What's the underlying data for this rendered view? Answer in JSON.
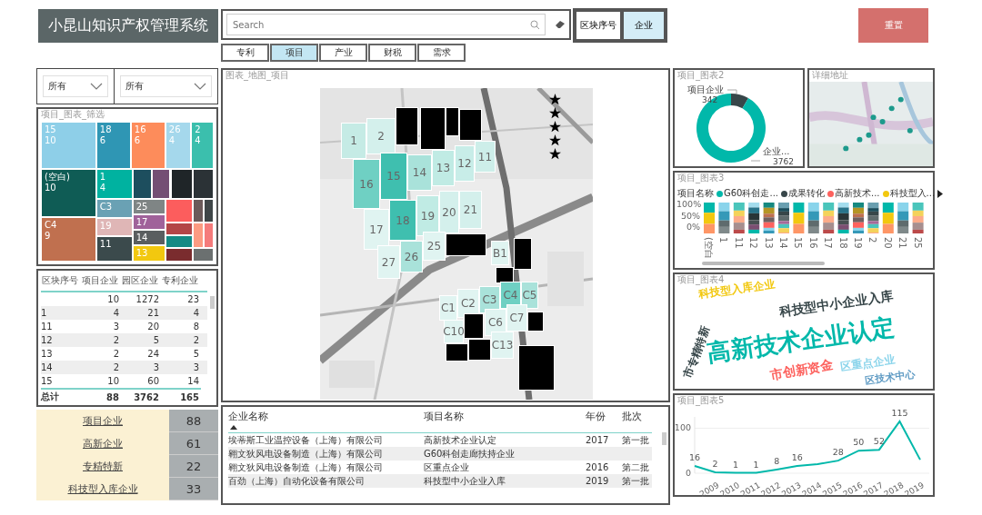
{
  "header": {
    "title": "小昆山知识产权管理系统",
    "search": {
      "placeholder": "Search"
    },
    "view_buttons": [
      {
        "label": "区块序号",
        "selected": false
      },
      {
        "label": "企业",
        "selected": true
      }
    ],
    "reset_button": "重置"
  },
  "tabs": [
    {
      "label": "专利",
      "selected": false
    },
    {
      "label": "项目",
      "selected": true
    },
    {
      "label": "产业",
      "selected": false
    },
    {
      "label": "财税",
      "selected": false
    },
    {
      "label": "需求",
      "selected": false
    }
  ],
  "filters": [
    {
      "value": "所有"
    },
    {
      "value": "所有"
    }
  ],
  "treemap": {
    "title": "项目_图表_筛选",
    "tiles": [
      {
        "label": "15",
        "value": "10",
        "color": "#8ecfe8"
      },
      {
        "label": "18",
        "value": "6",
        "color": "#2f96b4"
      },
      {
        "label": "16",
        "value": "6",
        "color": "#fd8c5b"
      },
      {
        "label": "26",
        "value": "4",
        "color": "#a5d8ec"
      },
      {
        "label": "2",
        "value": "4",
        "color": "#3bbfad"
      },
      {
        "label": "(空白)",
        "value": "10",
        "color": "#0f5c55"
      },
      {
        "label": "1",
        "value": "4",
        "color": "#00b2a0"
      },
      {
        "color": "#1d4e5e"
      },
      {
        "color": "#744e74"
      },
      {
        "color": "#1f2528"
      },
      {
        "color": "#2b3236"
      },
      {
        "label": "C3",
        "color": "#6aa1b4"
      },
      {
        "label": "25",
        "color": "#7f8585"
      },
      {
        "label": "17",
        "color": "#a0629a"
      },
      {
        "label": "14",
        "color": "#5a5e60"
      },
      {
        "label": "13",
        "color": "#f2c80f"
      },
      {
        "color": "#fc5d5d"
      },
      {
        "color": "#6b5a5a"
      },
      {
        "color": "#3f4648"
      },
      {
        "color": "#b34547"
      },
      {
        "color": "#148a84"
      },
      {
        "color": "#7a2c2e"
      },
      {
        "color": "#fc9b82"
      },
      {
        "color": "#f57b7b"
      },
      {
        "color": "#6b7070"
      },
      {
        "label": "C4",
        "value": "9",
        "color": "#c0704f"
      },
      {
        "label": "19",
        "color": "#dfb6b6"
      },
      {
        "label": "11",
        "color": "#3b4a4c"
      }
    ]
  },
  "block_table": {
    "columns": [
      "区块序号",
      "项目企业",
      "园区企业",
      "专利企业"
    ],
    "rows": [
      [
        "",
        "10",
        "1272",
        "23"
      ],
      [
        "1",
        "4",
        "21",
        "4"
      ],
      [
        "11",
        "3",
        "20",
        "8"
      ],
      [
        "12",
        "2",
        "5",
        "2"
      ],
      [
        "13",
        "2",
        "24",
        "5"
      ],
      [
        "14",
        "2",
        "3",
        "3"
      ],
      [
        "15",
        "10",
        "60",
        "14"
      ]
    ],
    "total": [
      "总计",
      "88",
      "3762",
      "165"
    ]
  },
  "kpis": [
    {
      "label": "项目企业",
      "value": "88"
    },
    {
      "label": "高新企业",
      "value": "61"
    },
    {
      "label": "专精特新",
      "value": "22"
    },
    {
      "label": "科技型入库企业",
      "value": "33"
    }
  ],
  "map_panel": {
    "title": "图表_地图_项目",
    "blocks": [
      {
        "label": "1",
        "color": "#c5ebe5"
      },
      {
        "label": "2",
        "color": "#d4f0ec"
      },
      {
        "color": "#000000"
      },
      {
        "color": "#000000"
      },
      {
        "color": "#000000"
      },
      {
        "color": "#000000"
      },
      {
        "label": "16",
        "color": "#6fd0c3"
      },
      {
        "label": "15",
        "color": "#3fbfaf"
      },
      {
        "label": "14",
        "color": "#a9e2da"
      },
      {
        "label": "13",
        "color": "#c0ebe4"
      },
      {
        "label": "12",
        "color": "#c8ede8"
      },
      {
        "label": "11",
        "color": "#cdeee9"
      },
      {
        "label": "17",
        "color": "#e0f4f1"
      },
      {
        "label": "18",
        "color": "#3fbfaf"
      },
      {
        "label": "19",
        "color": "#c0ebe4"
      },
      {
        "label": "20",
        "color": "#d4f0ec"
      },
      {
        "label": "21",
        "color": "#d4f0ec"
      },
      {
        "label": "27",
        "color": "#e0f4f1"
      },
      {
        "label": "26",
        "color": "#a9e2da"
      },
      {
        "label": "25",
        "color": "#e0f4f1"
      },
      {
        "color": "#000000"
      },
      {
        "label": "B1",
        "color": "#e0f4f1"
      },
      {
        "color": "#000000"
      },
      {
        "color": "#000000"
      },
      {
        "label": "C1",
        "color": "#e0f4f1"
      },
      {
        "label": "C2",
        "color": "#e0f4f1"
      },
      {
        "label": "C3",
        "color": "#a9e2da"
      },
      {
        "label": "C4",
        "color": "#6fd0c3"
      },
      {
        "label": "C5",
        "color": "#a9e2da"
      },
      {
        "label": "C6",
        "color": "#e0f4f1"
      },
      {
        "label": "C7",
        "color": "#e0f4f1"
      },
      {
        "label": "C10",
        "color": "#e0f4f1"
      },
      {
        "label": "C13",
        "color": "#e0f4f1"
      },
      {
        "color": "#000000"
      },
      {
        "color": "#000000"
      },
      {
        "color": "#000000"
      },
      {
        "color": "#000000"
      },
      {
        "color": "#000000"
      }
    ]
  },
  "company_table": {
    "columns": [
      {
        "label": "企业名称",
        "sorted": true
      },
      {
        "label": "项目名称",
        "sorted": false
      },
      {
        "label": "年份",
        "sorted": false
      },
      {
        "label": "批次",
        "sorted": false
      }
    ],
    "rows": [
      [
        "埃蒂斯工业温控设备（上海）有限公司",
        "高新技术企业认定",
        "2017",
        "第一批"
      ],
      [
        "翱文狄风电设备制造（上海）有限公司",
        "G60科创走廊扶持企业",
        "",
        ""
      ],
      [
        "翱文狄风电设备制造（上海）有限公司",
        "区重点企业",
        "2016",
        "第二批"
      ],
      [
        "百劲（上海）自动化设备有限公司",
        "科技型中小企业入库",
        "2019",
        "第一批"
      ]
    ]
  },
  "donut_panel": {
    "title": "项目_图表2",
    "chart_data": {
      "type": "donut",
      "categories": [
        "项目企业",
        "企业..."
      ],
      "values": [
        342,
        3762
      ],
      "data_labels": true
    }
  },
  "address_map": {
    "title": "详细地址",
    "kind": "picture"
  },
  "bar_panel": {
    "title": "项目_图表3",
    "legend_title": "项目名称",
    "legend": [
      {
        "name": "G60科创走...",
        "color": "#01b8aa"
      },
      {
        "name": "成果转化",
        "color": "#374649"
      },
      {
        "name": "高新技术...",
        "color": "#fd625e"
      },
      {
        "name": "科技型入...",
        "color": "#f2c80f"
      }
    ],
    "yticks": [
      "100%",
      "50%",
      "0%"
    ],
    "categories": [
      "(空白",
      "1",
      "11",
      "12",
      "13",
      "14",
      "15",
      "16",
      "17",
      "18",
      "19",
      "2",
      "20",
      "21",
      "25"
    ]
  },
  "wordcloud_panel": {
    "title": "项目_图表4",
    "words": [
      {
        "text": "高新技术企业认定",
        "color": "#01b8aa"
      },
      {
        "text": "科技型中小企业入库",
        "color": "#374649"
      },
      {
        "text": "市创新资金",
        "color": "#fd625e"
      },
      {
        "text": "科技型入库企业",
        "color": "#f2c80f"
      },
      {
        "text": "区重点企业",
        "color": "#8ad4eb"
      },
      {
        "text": "区技术中心",
        "color": "#5f9bc4"
      },
      {
        "text": "市专精特新",
        "color": "#374649"
      }
    ]
  },
  "line_panel": {
    "title": "项目_图表5",
    "chart_data": {
      "type": "line",
      "categories": [
        null,
        "2009",
        "2010",
        "2011",
        "2012",
        "2013",
        "2014",
        "2015",
        "2016",
        "2017",
        "2018",
        "2019"
      ],
      "series": [
        {
          "color": "#01b8aa",
          "values": [
            16,
            2,
            1,
            1,
            8,
            16,
            20,
            28,
            50,
            52,
            115,
            30
          ]
        }
      ],
      "yticks": [
        0,
        100
      ],
      "ylim": [
        0,
        125
      ],
      "value_labels": [
        "16",
        "2",
        "1",
        "1",
        "8",
        "16",
        null,
        "28",
        "50",
        "52",
        "115",
        null
      ]
    }
  }
}
